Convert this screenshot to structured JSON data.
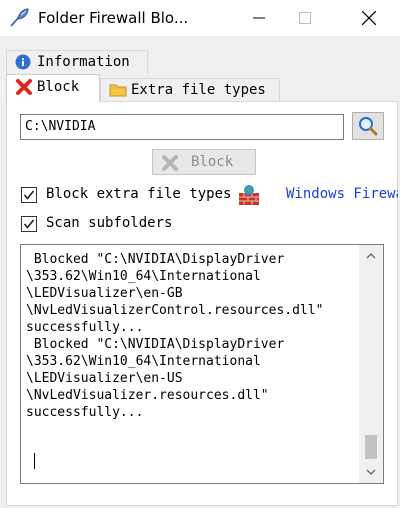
{
  "window": {
    "title": "Folder Firewall Blo...",
    "icons": {
      "app": "feather-pen-icon",
      "minimize": "minimize-icon",
      "maximize": "maximize-icon",
      "close": "close-icon"
    }
  },
  "tabs": [
    {
      "label": "Information",
      "icon": "info-icon",
      "selected": false
    },
    {
      "label": "Block",
      "icon": "red-x-icon",
      "selected": true
    },
    {
      "label": "Extra file types",
      "icon": "folder-icon",
      "selected": false
    }
  ],
  "block_tab": {
    "path_value": "C:\\NVIDIA",
    "browse_icon": "magnifier-icon",
    "block_button": {
      "label": "Block",
      "icon": "gray-x-icon",
      "enabled": false
    },
    "checkbox_extra": {
      "label": "Block extra file types",
      "checked": true
    },
    "checkbox_sub": {
      "label": "Scan subfolders",
      "checked": true
    },
    "brick_icon": "firewall-brick-icon",
    "firewall_link": "Windows Firewall",
    "log_lines": [
      " Blocked \"C:\\NVIDIA\\DisplayDriver",
      "\\353.62\\Win10_64\\International",
      "\\LEDVisualizer\\en-GB",
      "\\NvLedVisualizerControl.resources.dll\"",
      "successfully...",
      "",
      " Blocked \"C:\\NVIDIA\\DisplayDriver",
      "\\353.62\\Win10_64\\International",
      "\\LEDVisualizer\\en-US",
      "\\NvLedVisualizer.resources.dll\"",
      "successfully..."
    ]
  },
  "colors": {
    "link": "#1a3fd6",
    "accent_red": "#e0251b",
    "disabled_text": "#8d8d8d"
  }
}
